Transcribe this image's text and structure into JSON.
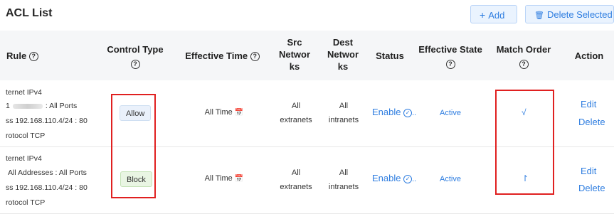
{
  "title": "ACL List",
  "toolbar": {
    "add_label": "Add",
    "delete_label": "Delete Selected"
  },
  "headers": {
    "rule": "Rule",
    "control_type_line1": "Control Type",
    "effective_time": "Effective Time",
    "src_line1": "Src",
    "src_line2": "Networ",
    "src_line3": "ks",
    "dest_line1": "Dest",
    "dest_line2": "Networ",
    "dest_line3": "ks",
    "status": "Status",
    "effective_state": "Effective State",
    "match_order": "Match Order",
    "action": "Action"
  },
  "rows": [
    {
      "rule_line1": "ternet IPv4",
      "rule_line2_a": "1",
      "rule_line2_b": ": All Ports",
      "rule_line3": "ss 192.168.110.4/24 : 80",
      "rule_line4": "rotocol TCP",
      "control_type": "Allow",
      "effective_time": "All Time",
      "src_line1": "All",
      "src_line2": "extranets",
      "dest_line1": "All",
      "dest_line2": "intranets",
      "status": "Enable",
      "status_more": "..",
      "effective_state": "Active",
      "match_order": "√",
      "edit": "Edit",
      "delete": "Delete"
    },
    {
      "rule_line1": "ternet IPv4",
      "rule_line2_a": "All Addresses : All Ports",
      "rule_line2_b": "",
      "rule_line3": "ss 192.168.110.4/24 : 80",
      "rule_line4": "rotocol TCP",
      "control_type": "Block",
      "effective_time": "All Time",
      "src_line1": "All",
      "src_line2": "extranets",
      "dest_line1": "All",
      "dest_line2": "intranets",
      "status": "Enable",
      "status_more": "..",
      "effective_state": "Active",
      "match_order": "↾",
      "edit": "Edit",
      "delete": "Delete"
    }
  ],
  "icons": {
    "help": "?",
    "plus": "+",
    "trash": "🗑",
    "calendar": "📅",
    "check_circle": "✓"
  },
  "colors": {
    "accent": "#2e7de0",
    "highlight_box": "#e02020"
  }
}
